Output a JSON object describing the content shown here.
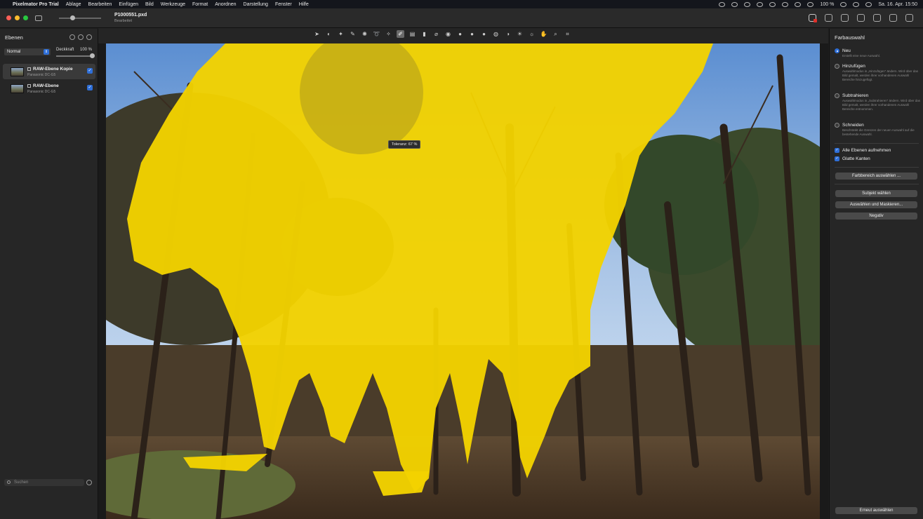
{
  "menubar": {
    "app_name": "Pixelmator Pro Trial",
    "menus": [
      "Ablage",
      "Bearbeiten",
      "Einfügen",
      "Bild",
      "Werkzeuge",
      "Format",
      "Anordnen",
      "Darstellung",
      "Fenster",
      "Hilfe"
    ],
    "battery": "100 %",
    "datetime": "Sa. 16. Apr. 15:50"
  },
  "document": {
    "title": "P1000551.pxd",
    "subtitle": "Bearbeitet"
  },
  "layers_panel": {
    "title": "Ebenen",
    "blend_mode": "Normal",
    "opacity_label": "Deckkraft",
    "opacity_value": "100 %",
    "layers": [
      {
        "name": "RAW-Ebene Kopie",
        "camera": "Panasonic DC-G5"
      },
      {
        "name": "RAW-Ebene",
        "camera": "Panasonic DC-G5"
      }
    ],
    "search_placeholder": "Suchen"
  },
  "canvas": {
    "tooltip": "Toleranz: 67 %"
  },
  "color_select_panel": {
    "title": "Farbauswahl",
    "modes": [
      {
        "label": "Neu",
        "desc": "Erstellt eine neue Auswahl.",
        "selected": true
      },
      {
        "label": "Hinzufügen",
        "desc": "Auswahlmodus in „Hinzufügen“ ändern. Wird über das Bild gemalt, werden ihrer vorhandenen Auswahl Bereiche hinzugefügt.",
        "selected": false
      },
      {
        "label": "Subtrahieren",
        "desc": "Auswahlmodus in „Subtrahieren“ ändern. Wird über das Bild gemalt, werden ihrer vorhandenen Auswahl Bereiche entnommen.",
        "selected": false
      },
      {
        "label": "Schneiden",
        "desc": "Beschränkt die Grenzen der neuen Auswahl auf die bestehende Auswahl.",
        "selected": false
      }
    ],
    "checkboxes": {
      "all_layers": "Alle Ebenen aufnehmen",
      "smooth_edges": "Glatte Kanten"
    },
    "buttons": {
      "color_range": "Farbbereich auswählen ...",
      "select_subject": "Subjekt wählen",
      "select_and_mask": "Auswählen und Maskieren...",
      "invert": "Negativ",
      "reselect": "Erneut auswählen"
    }
  },
  "colors": {
    "selection_overlay": "#f2d200",
    "accent": "#2f6fd8"
  }
}
